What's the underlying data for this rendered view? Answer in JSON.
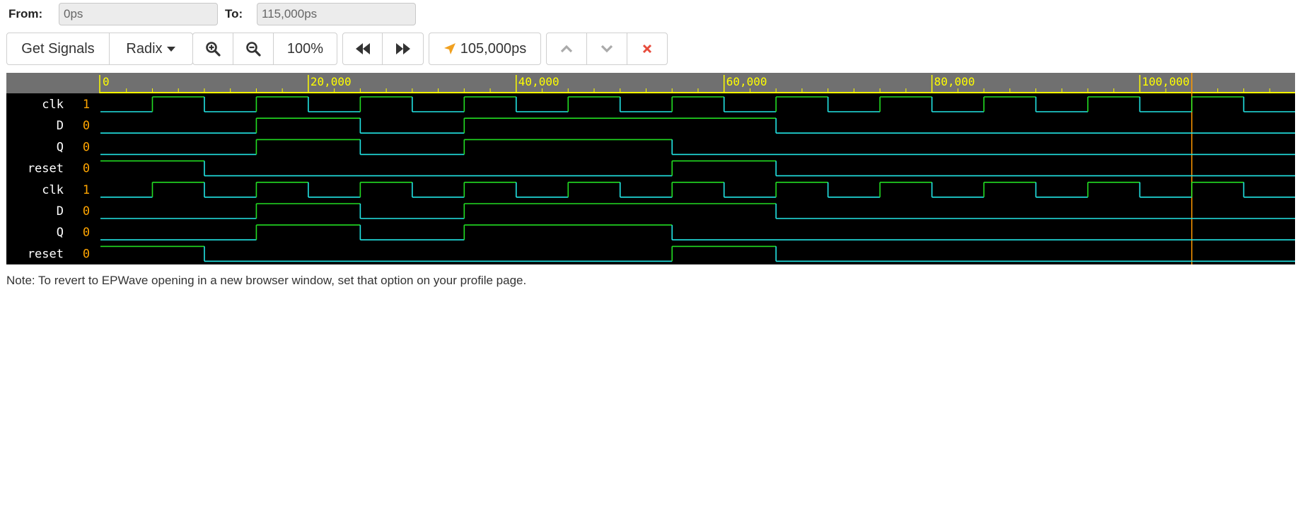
{
  "range": {
    "from_label": "From:",
    "from_value": "0ps",
    "to_label": "To:",
    "to_value": "115,000ps"
  },
  "toolbar": {
    "get_signals_label": "Get Signals",
    "radix_label": "Radix",
    "zoom_level": "100%",
    "cursor_time": "105,000ps"
  },
  "colors": {
    "header_bg": "#707070",
    "timeline": "#ffff00",
    "signal_name": "#ffffff",
    "signal_value": "#ffa500",
    "wave_high": "#22dd22",
    "wave_low": "#22e5e5",
    "cursor": "#ff9900",
    "close_icon": "#e74c3c"
  },
  "wave": {
    "time_start_ps": 0,
    "time_end_ps": 115000,
    "ruler_labels": [
      "0",
      "20,000",
      "40,000",
      "60,000",
      "80,000",
      "100,000"
    ],
    "cursor_ps": 105000,
    "signals": [
      {
        "name": "clk",
        "value": "1",
        "transitions": [
          [
            0,
            0
          ],
          [
            5000,
            1
          ],
          [
            10000,
            0
          ],
          [
            15000,
            1
          ],
          [
            20000,
            0
          ],
          [
            25000,
            1
          ],
          [
            30000,
            0
          ],
          [
            35000,
            1
          ],
          [
            40000,
            0
          ],
          [
            45000,
            1
          ],
          [
            50000,
            0
          ],
          [
            55000,
            1
          ],
          [
            60000,
            0
          ],
          [
            65000,
            1
          ],
          [
            70000,
            0
          ],
          [
            75000,
            1
          ],
          [
            80000,
            0
          ],
          [
            85000,
            1
          ],
          [
            90000,
            0
          ],
          [
            95000,
            1
          ],
          [
            100000,
            0
          ],
          [
            105000,
            1
          ],
          [
            110000,
            0
          ],
          [
            115000,
            1
          ]
        ]
      },
      {
        "name": "D",
        "value": "0",
        "transitions": [
          [
            0,
            0
          ],
          [
            15000,
            1
          ],
          [
            25000,
            0
          ],
          [
            35000,
            1
          ],
          [
            65000,
            0
          ]
        ]
      },
      {
        "name": "Q",
        "value": "0",
        "transitions": [
          [
            0,
            0
          ],
          [
            15000,
            1
          ],
          [
            25000,
            0
          ],
          [
            35000,
            1
          ],
          [
            55000,
            0
          ]
        ]
      },
      {
        "name": "reset",
        "value": "0",
        "transitions": [
          [
            0,
            1
          ],
          [
            10000,
            0
          ],
          [
            55000,
            1
          ],
          [
            65000,
            0
          ]
        ]
      },
      {
        "name": "clk",
        "value": "1",
        "transitions": [
          [
            0,
            0
          ],
          [
            5000,
            1
          ],
          [
            10000,
            0
          ],
          [
            15000,
            1
          ],
          [
            20000,
            0
          ],
          [
            25000,
            1
          ],
          [
            30000,
            0
          ],
          [
            35000,
            1
          ],
          [
            40000,
            0
          ],
          [
            45000,
            1
          ],
          [
            50000,
            0
          ],
          [
            55000,
            1
          ],
          [
            60000,
            0
          ],
          [
            65000,
            1
          ],
          [
            70000,
            0
          ],
          [
            75000,
            1
          ],
          [
            80000,
            0
          ],
          [
            85000,
            1
          ],
          [
            90000,
            0
          ],
          [
            95000,
            1
          ],
          [
            100000,
            0
          ],
          [
            105000,
            1
          ],
          [
            110000,
            0
          ],
          [
            115000,
            1
          ]
        ]
      },
      {
        "name": "D",
        "value": "0",
        "transitions": [
          [
            0,
            0
          ],
          [
            15000,
            1
          ],
          [
            25000,
            0
          ],
          [
            35000,
            1
          ],
          [
            65000,
            0
          ]
        ]
      },
      {
        "name": "Q",
        "value": "0",
        "transitions": [
          [
            0,
            0
          ],
          [
            15000,
            1
          ],
          [
            25000,
            0
          ],
          [
            35000,
            1
          ],
          [
            55000,
            0
          ]
        ]
      },
      {
        "name": "reset",
        "value": "0",
        "transitions": [
          [
            0,
            1
          ],
          [
            10000,
            0
          ],
          [
            55000,
            1
          ],
          [
            65000,
            0
          ]
        ]
      }
    ]
  },
  "note": "Note: To revert to EPWave opening in a new browser window, set that option on your profile page."
}
